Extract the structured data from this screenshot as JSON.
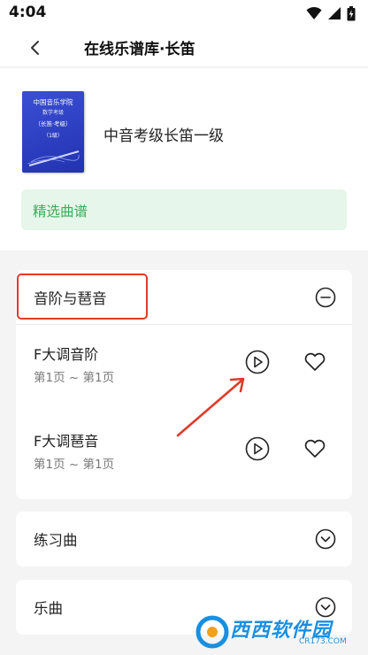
{
  "status_bar": {
    "time": "4:04"
  },
  "app_bar": {
    "title": "在线乐谱库·长笛"
  },
  "book": {
    "cover": {
      "line1": "中国音乐学院",
      "line2": "数学考级",
      "line3": "（长笛·考级）",
      "line4": "（1级）"
    },
    "title": "中音考级长笛一级",
    "tag": "精选曲谱"
  },
  "sections": [
    {
      "title": "音阶与琶音",
      "expanded": true,
      "items": [
        {
          "title": "F大调音阶",
          "pages": "第1页 ~ 第1页"
        },
        {
          "title": "F大调琶音",
          "pages": "第1页 ~ 第1页"
        }
      ]
    },
    {
      "title": "练习曲",
      "expanded": false
    },
    {
      "title": "乐曲",
      "expanded": false
    }
  ],
  "colors": {
    "accent_green": "#3aac5a",
    "tag_bg": "#e6f6ea",
    "annotation_red": "#e03a2a",
    "cover_blue": "#2f43c8",
    "watermark_blue": "#1a8fe0"
  },
  "watermark": {
    "text": "西西软件园",
    "url": "CR173.COM"
  }
}
